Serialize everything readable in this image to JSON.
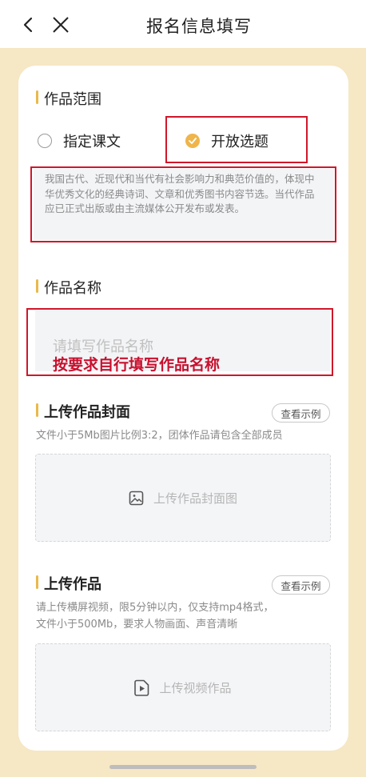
{
  "header": {
    "title": "报名信息填写"
  },
  "scope": {
    "title": "作品范围",
    "options": [
      {
        "label": "指定课文",
        "checked": false
      },
      {
        "label": "开放选题",
        "checked": true
      }
    ],
    "description": "我国古代、近现代和当代有社会影响力和典范价值的，体现中华优秀文化的经典诗词、文章和优秀图书内容节选。当代作品应已正式出版或由主流媒体公开发布或发表。"
  },
  "name": {
    "title": "作品名称",
    "placeholder": "请填写作品名称",
    "annotation": "按要求自行填写作品名称"
  },
  "cover": {
    "title": "上传作品封面",
    "example_label": "查看示例",
    "hint": "文件小于5Mb图片比例3:2，团体作品请包含全部成员",
    "upload_label": "上传作品封面图"
  },
  "work": {
    "title": "上传作品",
    "example_label": "查看示例",
    "hint_line1": "请上传横屏视频，限5分钟以内，仅支持mp4格式，",
    "hint_line2": "文件小于500Mb，要求人物画面、声音清晰",
    "upload_label": "上传视频作品"
  },
  "colors": {
    "accent": "#efb54a",
    "background": "#f6e7c5",
    "annotation_red": "#c8102e"
  }
}
